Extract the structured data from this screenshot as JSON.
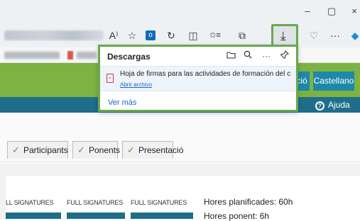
{
  "window": {
    "minimize": "–",
    "maximize": "▢",
    "close": "×"
  },
  "toolbar": {
    "read_aloud": "A⁾",
    "favorite": "☆",
    "outlook": "o",
    "extensions": "↻",
    "split": "◫",
    "favorites_list": "✩≡",
    "collections": "⧉",
    "download": "⤓",
    "health": "♡",
    "more": "···",
    "copilot": "◆"
  },
  "downloads": {
    "title": "Descargas",
    "file_name": "Hoja de firmas para las actividades de formación del ce...",
    "open_file": "Abrir archivo",
    "see_more": "Ver más",
    "icons": {
      "folder": "folder-icon",
      "search": "search-icon",
      "more": "more-icon",
      "pin": "pin-icon"
    }
  },
  "page": {
    "lang_catalan": "ció",
    "lang_spanish": "Castellano",
    "help": "Ajuda",
    "tabs": [
      {
        "label": "Participants"
      },
      {
        "label": "Ponents"
      },
      {
        "label": "Presentació"
      }
    ],
    "signature_labels": [
      "LL SIGNATURES",
      "FULL SIGNATURES",
      "FULL SIGNATURES"
    ],
    "planned_hours": "Hores planificades: 60h",
    "speaker_hours": "Hores ponent: 6h"
  },
  "colors": {
    "accent_green": "#6aa84f",
    "header_green": "#7cb342",
    "teal": "#1e6e8a",
    "button_blue": "#1e88a8"
  }
}
